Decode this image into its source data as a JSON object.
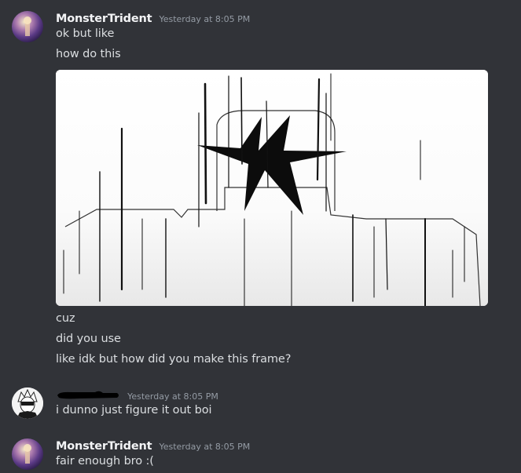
{
  "messages": [
    {
      "username": "MonsterTrident",
      "timestamp": "Yesterday at 8:05 PM",
      "lines": [
        "ok but like",
        "how do this"
      ],
      "attachment": {
        "icon": "image-attachment"
      },
      "followups": [
        "cuz",
        "did you use",
        "like idk but how did you make this frame?"
      ]
    },
    {
      "username": "",
      "timestamp": "Yesterday at 8:05 PM",
      "lines": [
        "i dunno just figure it out boi"
      ]
    },
    {
      "username": "MonsterTrident",
      "timestamp": "Yesterday at 8:05 PM",
      "lines": [
        "fair enough bro :("
      ]
    }
  ],
  "colors": {
    "background": "#313338",
    "username": "#f2f3f5",
    "text": "#dbdee1",
    "timestamp": "#949ba4"
  }
}
